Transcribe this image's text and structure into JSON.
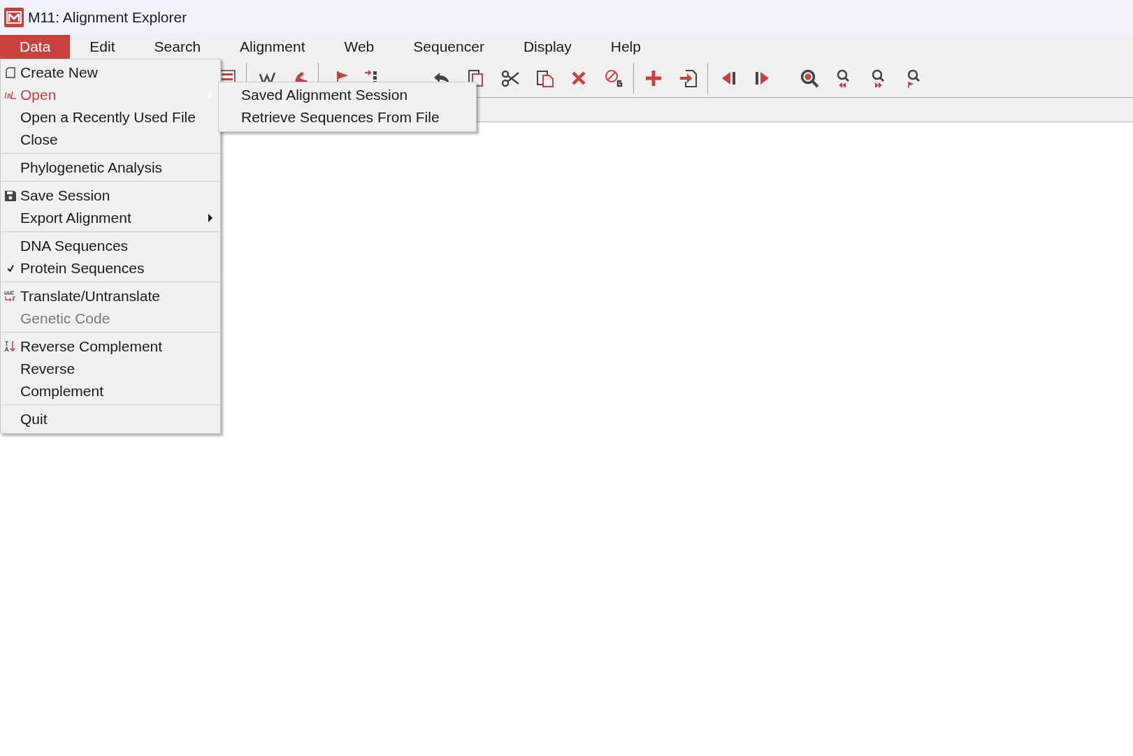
{
  "window": {
    "title": "M11: Alignment Explorer"
  },
  "menu_bar": [
    {
      "label": "Data",
      "selected": true
    },
    {
      "label": "Edit",
      "selected": false
    },
    {
      "label": "Search",
      "selected": false
    },
    {
      "label": "Alignment",
      "selected": false
    },
    {
      "label": "Web",
      "selected": false
    },
    {
      "label": "Sequencer",
      "selected": false
    },
    {
      "label": "Display",
      "selected": false
    },
    {
      "label": "Help",
      "selected": false
    }
  ],
  "data_menu": {
    "groups": [
      [
        {
          "label": "Create New",
          "selected": false,
          "disabled": false,
          "checked": false,
          "submenu": false
        },
        {
          "label": "Open",
          "selected": true,
          "disabled": false,
          "checked": false,
          "submenu": true
        },
        {
          "label": "Open a Recently Used File",
          "selected": false,
          "disabled": false,
          "checked": false,
          "submenu": false
        },
        {
          "label": "Close",
          "selected": false,
          "disabled": false,
          "checked": false,
          "submenu": false
        }
      ],
      [
        {
          "label": "Phylogenetic Analysis",
          "selected": false,
          "disabled": false,
          "checked": false,
          "submenu": false
        }
      ],
      [
        {
          "label": "Save Session",
          "selected": false,
          "disabled": false,
          "checked": false,
          "submenu": false
        },
        {
          "label": "Export Alignment",
          "selected": false,
          "disabled": false,
          "checked": false,
          "submenu": true
        }
      ],
      [
        {
          "label": "DNA Sequences",
          "selected": false,
          "disabled": false,
          "checked": false,
          "submenu": false
        },
        {
          "label": "Protein Sequences",
          "selected": false,
          "disabled": false,
          "checked": true,
          "submenu": false
        }
      ],
      [
        {
          "label": "Translate/Untranslate",
          "selected": false,
          "disabled": false,
          "checked": false,
          "submenu": false
        },
        {
          "label": "Genetic Code",
          "selected": false,
          "disabled": true,
          "checked": false,
          "submenu": false
        }
      ],
      [
        {
          "label": "Reverse Complement",
          "selected": false,
          "disabled": false,
          "checked": false,
          "submenu": false
        },
        {
          "label": "Reverse",
          "selected": false,
          "disabled": false,
          "checked": false,
          "submenu": false
        },
        {
          "label": "Complement",
          "selected": false,
          "disabled": false,
          "checked": false,
          "submenu": false
        }
      ],
      [
        {
          "label": "Quit",
          "selected": false,
          "disabled": false,
          "checked": false,
          "submenu": false
        }
      ]
    ]
  },
  "open_submenu": {
    "items": [
      {
        "label": "Saved Alignment Session"
      },
      {
        "label": "Retrieve Sequences From File"
      }
    ]
  }
}
